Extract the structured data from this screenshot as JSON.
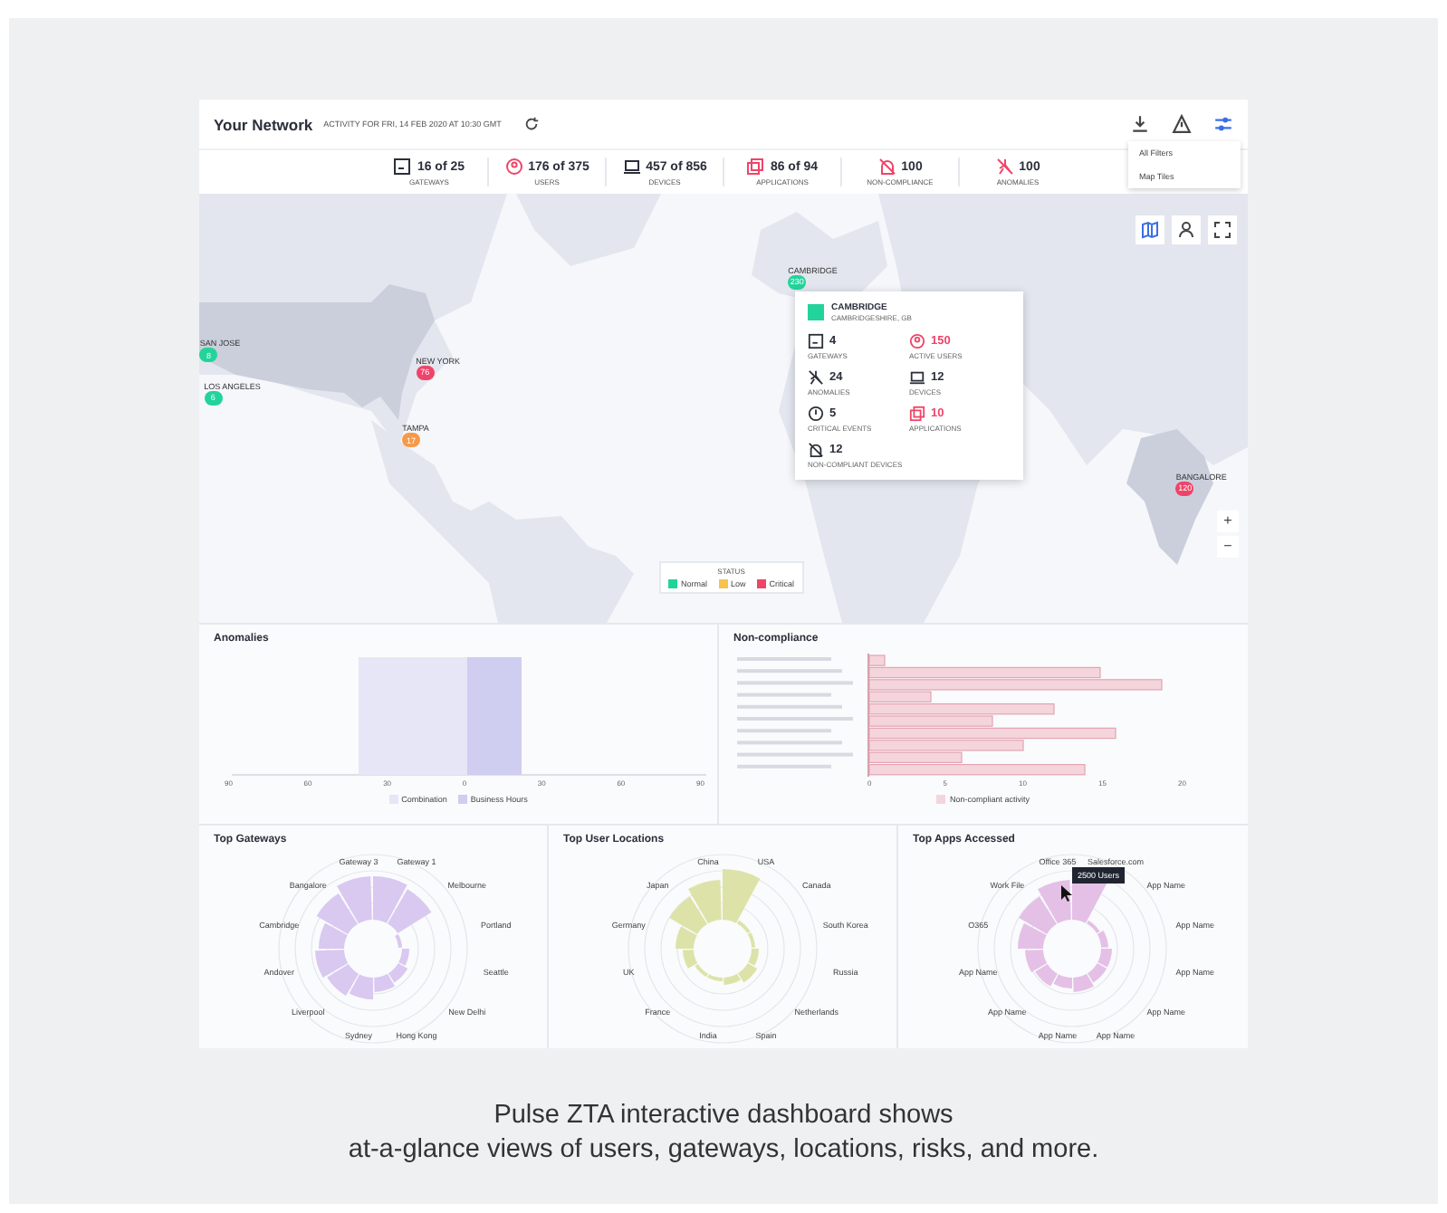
{
  "header": {
    "title": "Your Network",
    "subtitle": "ACTIVITY FOR FRI, 14 FEB 2020 AT 10:30 GMT"
  },
  "menu": {
    "items": [
      "All Filters",
      "Map Tiles"
    ]
  },
  "stats": [
    {
      "kind": "gateway",
      "alert": false,
      "value": "16 of 25",
      "label": "GATEWAYS"
    },
    {
      "kind": "user",
      "alert": true,
      "value": "176 of 375",
      "label": "USERS"
    },
    {
      "kind": "device",
      "alert": false,
      "value": "457 of 856",
      "label": "DEVICES"
    },
    {
      "kind": "app",
      "alert": true,
      "value": "86 of 94",
      "label": "APPLICATIONS"
    },
    {
      "kind": "noncompliance",
      "alert": true,
      "value": "100",
      "label": "NON-COMPLIANCE"
    },
    {
      "kind": "anomaly",
      "alert": true,
      "value": "100",
      "label": "ANOMALIES"
    }
  ],
  "markers": [
    {
      "city": "CAMBRIDGE",
      "count": "230",
      "color": "#22d49a"
    },
    {
      "city": "SAN JOSE",
      "count": "8",
      "color": "#22d49a"
    },
    {
      "city": "LOS ANGELES",
      "count": "6",
      "color": "#22d49a"
    },
    {
      "city": "NEW YORK",
      "count": "76",
      "color": "#ef4469"
    },
    {
      "city": "TAMPA",
      "count": "17",
      "color": "#f59a4a"
    },
    {
      "city": "BANGALORE",
      "count": "120",
      "color": "#ef4469"
    }
  ],
  "zoom_controls": [
    "+",
    "−"
  ],
  "tooltip": {
    "title": "CAMBRIDGE",
    "subtitle": "CAMBRIDGESHIRE, GB",
    "items": [
      {
        "kind": "gateway",
        "alert": false,
        "value": "4",
        "label": "GATEWAYS"
      },
      {
        "kind": "user",
        "alert": true,
        "value": "150",
        "label": "ACTIVE USERS"
      },
      {
        "kind": "anomaly",
        "alert": false,
        "value": "24",
        "label": "ANOMALIES"
      },
      {
        "kind": "device",
        "alert": false,
        "value": "12",
        "label": "DEVICES"
      },
      {
        "kind": "clock",
        "alert": false,
        "value": "5",
        "label": "CRITICAL EVENTS"
      },
      {
        "kind": "app",
        "alert": true,
        "value": "10",
        "label": "APPLICATIONS"
      },
      {
        "kind": "noncompliance",
        "alert": false,
        "value": "12",
        "label": "NON-COMPLIANT DEVICES"
      }
    ]
  },
  "legend": {
    "title": "STATUS",
    "items": [
      {
        "label": "Normal",
        "color": "#22d49a"
      },
      {
        "label": "Low",
        "color": "#f7c34c"
      },
      {
        "label": "Critical",
        "color": "#ef4469"
      }
    ]
  },
  "anomalies": {
    "title": "Anomalies",
    "ticks": [
      "90",
      "60",
      "30",
      "0",
      "30",
      "60",
      "90"
    ],
    "legend": [
      {
        "label": "Combination",
        "color": "#e6e6f6"
      },
      {
        "label": "Business Hours",
        "color": "#cfcdf0"
      }
    ]
  },
  "noncompliance": {
    "title": "Non-compliance",
    "ticks": [
      "0",
      "5",
      "10",
      "15",
      "20"
    ],
    "legend": "Non-compliant activity"
  },
  "roses": [
    {
      "title": "Top Gateways",
      "color": "#d9c8f0",
      "labels": [
        "Gateway 1",
        "Melbourne",
        "Portland",
        "Seattle",
        "New Delhi",
        "Hong Kong",
        "Sydney",
        "Liverpool",
        "Andover",
        "Cambridge",
        "Bangalore",
        "Gateway 3"
      ]
    },
    {
      "title": "Top User Locations",
      "color": "#dde3a8",
      "labels": [
        "USA",
        "Canada",
        "South Korea",
        "Russia",
        "Netherlands",
        "Spain",
        "India",
        "France",
        "UK",
        "Germany",
        "Japan",
        "China"
      ]
    },
    {
      "title": "Top Apps Accessed",
      "color": "#e4c0e6",
      "labels": [
        "Salesforce.com",
        "App Name",
        "App Name",
        "App Name",
        "App Name",
        "App Name",
        "App Name",
        "App Name",
        "App Name",
        "O365",
        "Work File",
        "Office 365"
      ],
      "hover": "2500 Users"
    }
  ],
  "caption": [
    "Pulse ZTA interactive dashboard shows",
    "at-a-glance views of users, gateways, locations, risks, and more."
  ]
}
